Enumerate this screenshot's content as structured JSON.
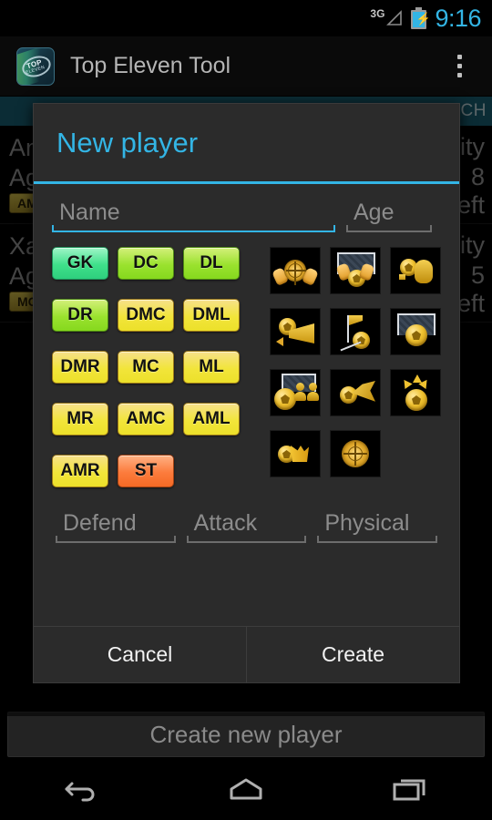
{
  "status_bar": {
    "network": "3G",
    "time": "9:16",
    "battery_icon": "battery-charging-icon",
    "signal_icon": "signal-icon"
  },
  "action_bar": {
    "app_icon": "top-eleven-app-icon",
    "title": "Top Eleven Tool",
    "overflow_icon": "overflow-menu-icon"
  },
  "background": {
    "header_partial": "WICH",
    "rows": [
      {
        "name_partial": "An",
        "age_partial": "Ag",
        "badge": "AM",
        "right_1": "lity",
        "right_2": "8",
        "right_3": "eft"
      },
      {
        "name_partial": "Xa",
        "age_partial": "Ag",
        "badge": "MC",
        "right_1": "lity",
        "right_2": "5",
        "right_3": "eft"
      }
    ],
    "create_new_player_button": "Create new player"
  },
  "dialog": {
    "title": "New player",
    "fields": {
      "name_placeholder": "Name",
      "name_value": "",
      "age_placeholder": "Age",
      "age_value": "",
      "defend_placeholder": "Defend",
      "defend_value": "",
      "attack_placeholder": "Attack",
      "attack_value": "",
      "physical_placeholder": "Physical",
      "physical_value": ""
    },
    "positions": [
      [
        {
          "label": "GK",
          "style": "gk"
        },
        {
          "label": "DC",
          "style": "grn"
        },
        {
          "label": "DL",
          "style": "grn"
        }
      ],
      [
        {
          "label": "DR",
          "style": "grn"
        },
        {
          "label": "DMC",
          "style": "yel"
        },
        {
          "label": "DML",
          "style": "yel"
        }
      ],
      [
        {
          "label": "DMR",
          "style": "yel"
        },
        {
          "label": "MC",
          "style": "yel"
        },
        {
          "label": "ML",
          "style": "yel"
        }
      ],
      [
        {
          "label": "MR",
          "style": "yel"
        },
        {
          "label": "AMC",
          "style": "yel"
        },
        {
          "label": "AML",
          "style": "yel"
        }
      ],
      [
        {
          "label": "AMR",
          "style": "yel"
        },
        {
          "label": "ST",
          "style": "st"
        }
      ]
    ],
    "skill_icons": [
      [
        "reflexes-icon",
        "positioning-icon",
        "handling-icon"
      ],
      [
        "one-on-one-icon",
        "aerial-ability-icon",
        "shot-stopping-icon"
      ],
      [
        "marking-icon",
        "tackling-icon",
        "heading-icon"
      ],
      [
        "finishing-icon",
        "creativity-icon"
      ]
    ],
    "buttons": {
      "cancel": "Cancel",
      "create": "Create"
    }
  },
  "nav_bar": {
    "back_icon": "back-icon",
    "home_icon": "home-icon",
    "recents_icon": "recents-icon"
  },
  "colors": {
    "accent": "#33B5E5",
    "header_teal": "#1A6277",
    "dialog_bg": "#2B2B2B",
    "position_gk": "#3FE08A",
    "position_green": "#9AE22E",
    "position_yellow": "#F2E53A",
    "position_striker": "#FC7B3C"
  }
}
